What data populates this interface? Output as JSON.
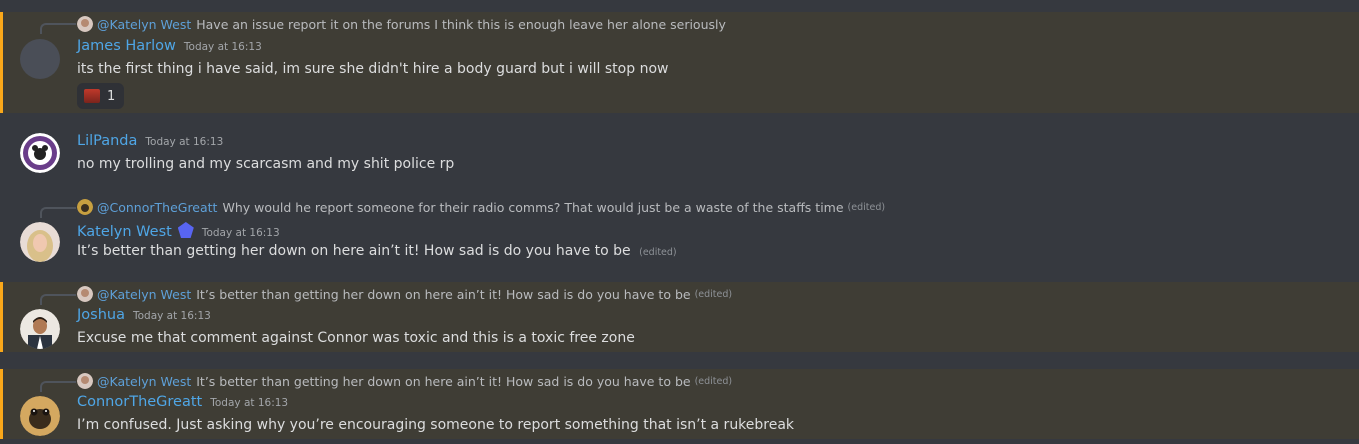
{
  "messages": [
    {
      "reply_to": "@Katelyn West",
      "reply_text": "Have an issue report it on the forums I think this is enough leave her alone seriously",
      "author": "James Harlow",
      "timestamp": "Today at 16:13",
      "content": "its the first thing i have said, im sure she didn't hire a body guard but i will stop now",
      "reaction_count": "1"
    },
    {
      "author": "LilPanda",
      "timestamp": "Today at 16:13",
      "content": "no my trolling and my scarcasm and my shit police rp"
    },
    {
      "reply_to": "@ConnorTheGreatt",
      "reply_text": "Why would he report someone for their radio comms? That would just be a waste of the staffs time",
      "reply_edited": "(edited)",
      "author": "Katelyn West",
      "timestamp": "Today at 16:13",
      "content": "It’s better than getting her down on here ain’t it! How sad is do you have to be",
      "edited": "(edited)"
    },
    {
      "reply_to": "@Katelyn West",
      "reply_text": "It’s better than getting her down on here ain’t it! How sad is do you have to be",
      "reply_edited": "(edited)",
      "author": "Joshua",
      "timestamp": "Today at 16:13",
      "content": "Excuse me that comment against Connor was toxic and this is a toxic free zone"
    },
    {
      "reply_to": "@Katelyn West",
      "reply_text": "It’s better than getting her down on here ain’t it! How sad is do you have to be",
      "reply_edited": "(edited)",
      "author": "ConnorTheGreatt",
      "timestamp": "Today at 16:13",
      "content": "I’m confused. Just asking why you’re encouraging someone to report something that isn’t a rukebreak"
    }
  ],
  "colors": {
    "background": "#36393f",
    "mention_highlight": "#3f3d35",
    "mention_bar": "#faa81a",
    "username": "#4fa6e6"
  }
}
